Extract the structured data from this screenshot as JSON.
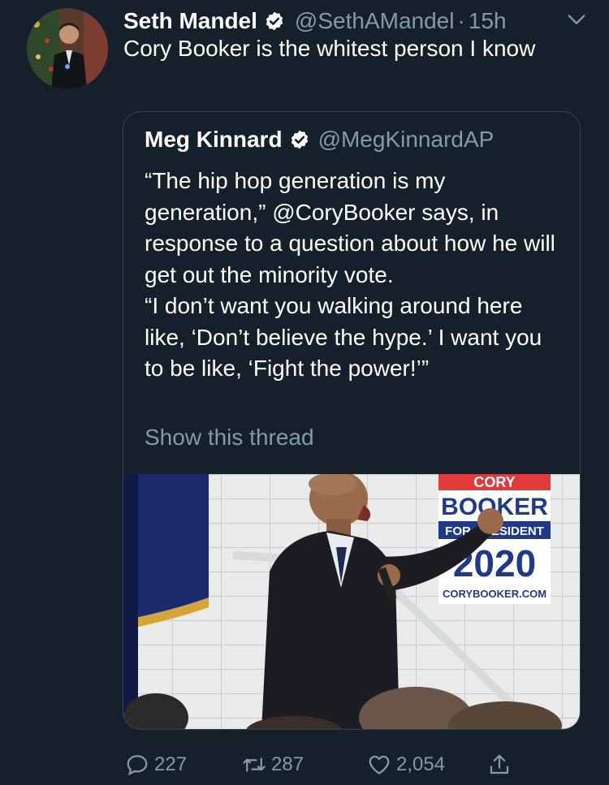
{
  "tweet": {
    "author_name": "Seth Mandel",
    "author_handle": "@SethAMandel",
    "separator": "·",
    "time": "15h",
    "text": "Cory Booker is the whitest person I know",
    "avatar_icon": "avatar-photo",
    "menu_icon": "chevron-down-icon"
  },
  "quoted": {
    "author_name": "Meg Kinnard",
    "author_handle": "@MegKinnardAP",
    "paragraph1": "“The hip hop generation is my generation,” @CoryBooker says, in response to a question about how he will get out the minority vote.",
    "paragraph2": "“I don’t want you walking around here like, ‘Don’t believe the hype.’ I want you to be like, ‘Fight the power!’”",
    "show_thread": "Show this thread",
    "sign": {
      "top": "CORY",
      "name": "BOOKER",
      "for": "FOR PRESIDENT",
      "year": "2020",
      "url": "CORYBOOKER.COM"
    }
  },
  "actions": {
    "replies": "227",
    "retweets": "287",
    "likes": "2,054"
  },
  "colors": {
    "background": "#15202b",
    "text": "#ffffff",
    "secondary": "#8899a6",
    "border": "#38444d"
  }
}
